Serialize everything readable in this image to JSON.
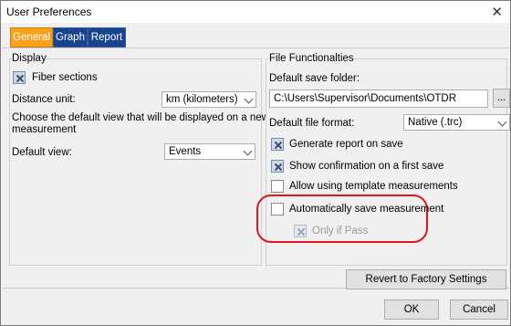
{
  "window": {
    "title": "User Preferences",
    "close_glyph": "✕"
  },
  "tabs": [
    {
      "label": "General",
      "active": true
    },
    {
      "label": "Graph",
      "active": false
    },
    {
      "label": "Report",
      "active": false
    }
  ],
  "display": {
    "legend": "Display",
    "fiber_sections_label": "Fiber sections",
    "fiber_sections_checked": true,
    "distance_unit_label": "Distance unit:",
    "distance_unit_value": "km (kilometers)",
    "choose_view_text_line1": "Choose the default view that will be displayed on a new",
    "choose_view_text_line2": "measurement",
    "default_view_label": "Default view:",
    "default_view_value": "Events"
  },
  "file": {
    "legend": "File Functionalties",
    "default_save_folder_label": "Default save folder:",
    "default_save_folder_value": "C:\\Users\\Supervisor\\Documents\\OTDR",
    "browse_label": "...",
    "default_format_label": "Default file format:",
    "default_format_value": "Native (.trc)",
    "generate_report_label": "Generate report on save",
    "generate_report_checked": true,
    "show_confirmation_label": "Show confirmation on a first save",
    "show_confirmation_checked": true,
    "allow_templates_label": "Allow using template measurements",
    "allow_templates_checked": false,
    "auto_save_label": "Automatically save measurement",
    "auto_save_checked": false,
    "only_if_pass_label": "Only if Pass",
    "only_if_pass_checked": true,
    "only_if_pass_disabled": true
  },
  "buttons": {
    "revert_label": "Revert to Factory Settings",
    "ok_label": "OK",
    "cancel_label": "Cancel"
  },
  "colors": {
    "active_tab": "#f9a11b",
    "inactive_tab": "#18448f",
    "highlight": "#e1141f"
  }
}
